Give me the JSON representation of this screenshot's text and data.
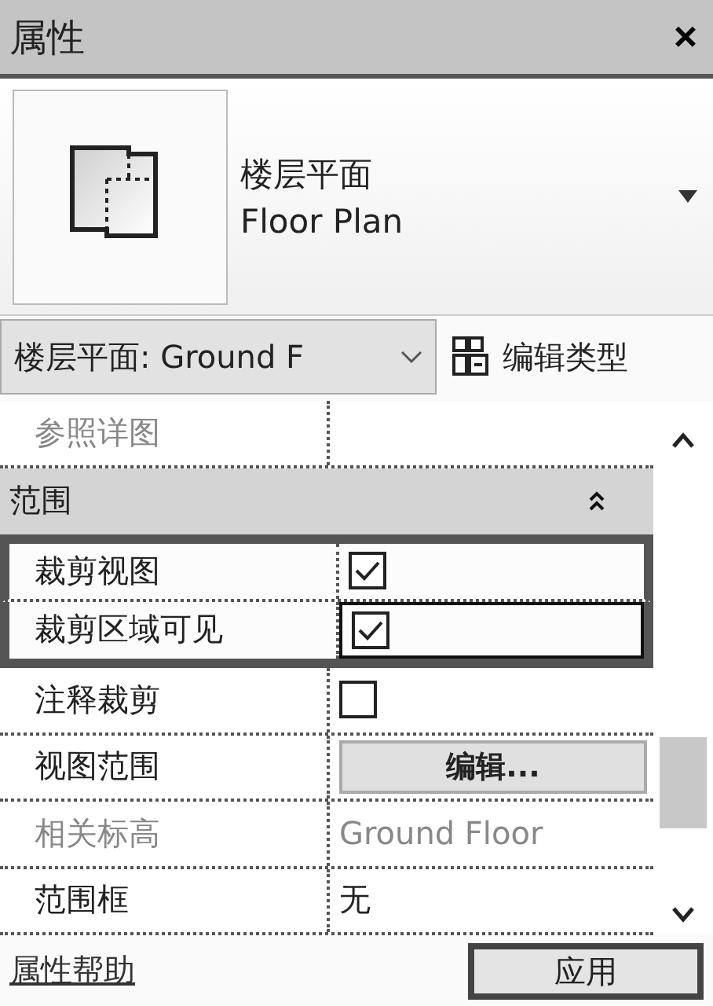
{
  "window": {
    "title": "属性",
    "close": "×"
  },
  "type_selector": {
    "name": "楼层平面",
    "subname": "Floor Plan"
  },
  "instance_dropdown": {
    "value": "楼层平面: Ground F"
  },
  "edit_type": {
    "label": "编辑类型"
  },
  "properties": [
    {
      "kind": "text",
      "label": "参照详图",
      "disabled": true,
      "highlighted": false,
      "focused": false
    },
    {
      "kind": "group",
      "label": "范围",
      "expanded": true
    },
    {
      "kind": "checkbox",
      "label": "裁剪视图",
      "checked": true,
      "disabled": false,
      "highlighted": true,
      "focused": false
    },
    {
      "kind": "checkbox",
      "label": "裁剪区域可见",
      "checked": true,
      "disabled": false,
      "highlighted": true,
      "focused": true
    },
    {
      "kind": "checkbox",
      "label": "注释裁剪",
      "checked": false,
      "disabled": false,
      "highlighted": false,
      "focused": false
    },
    {
      "kind": "button",
      "label": "视图范围",
      "value": "编辑...",
      "disabled": false,
      "highlighted": false,
      "focused": false
    },
    {
      "kind": "text",
      "label": "相关标高",
      "value": "Ground Floor",
      "disabled": true,
      "highlighted": false,
      "focused": false
    },
    {
      "kind": "text",
      "label": "范围框",
      "value": "无",
      "disabled": false,
      "highlighted": false,
      "focused": false
    }
  ],
  "footer": {
    "help_link": "属性帮助",
    "apply_button": "应用"
  }
}
